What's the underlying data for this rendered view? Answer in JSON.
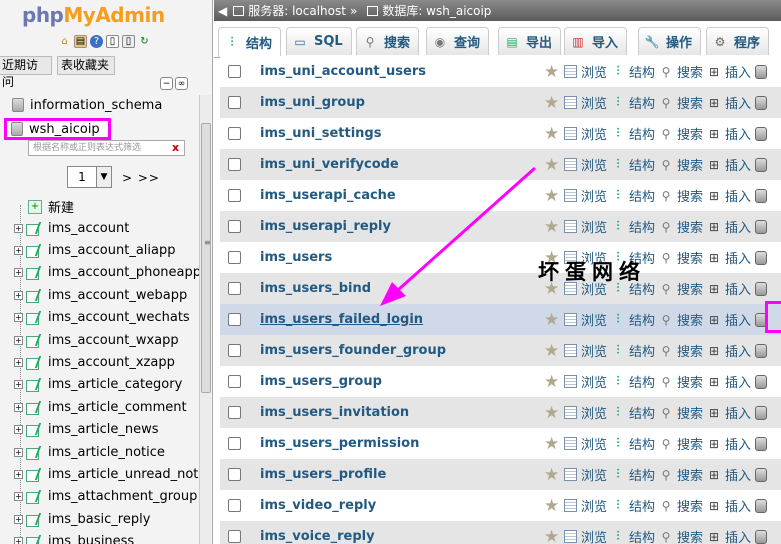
{
  "app": {
    "logo_php": "php",
    "logo_my": "My",
    "logo_admin": "Admin"
  },
  "left": {
    "btn_recent": "近期访问",
    "btn_fav": "表收藏夹",
    "databases": [
      "information_schema",
      "wsh_aicoip"
    ],
    "filter_placeholder": "根据名称或正则表达式筛选",
    "filter_clear": "x",
    "page_value": "1",
    "page_next": "> >>",
    "new_label": "新建",
    "tables": [
      "ims_account",
      "ims_account_aliapp",
      "ims_account_phoneapp",
      "ims_account_webapp",
      "ims_account_wechats",
      "ims_account_wxapp",
      "ims_account_xzapp",
      "ims_article_category",
      "ims_article_comment",
      "ims_article_news",
      "ims_article_notice",
      "ims_article_unread_notic",
      "ims_attachment_group",
      "ims_basic_reply",
      "ims_business"
    ]
  },
  "crumb": {
    "server_label": "服务器: localhost",
    "sep": "»",
    "db_label": "数据库: wsh_aicoip"
  },
  "tabs": [
    "结构",
    "SQL",
    "搜索",
    "查询",
    "导出",
    "导入",
    "操作",
    "程序"
  ],
  "actions": {
    "browse": "浏览",
    "structure": "结构",
    "search": "搜索",
    "insert": "插入"
  },
  "rows": [
    "ims_uni_account_users",
    "ims_uni_group",
    "ims_uni_settings",
    "ims_uni_verifycode",
    "ims_userapi_cache",
    "ims_userapi_reply",
    "ims_users",
    "ims_users_bind",
    "ims_users_failed_login",
    "ims_users_founder_group",
    "ims_users_group",
    "ims_users_invitation",
    "ims_users_permission",
    "ims_users_profile",
    "ims_video_reply",
    "ims_voice_reply"
  ],
  "highlight_row": "ims_users_failed_login",
  "annotation": "坏蛋网络",
  "colors": {
    "highlight": "#ff00ff",
    "link": "#235a81"
  }
}
